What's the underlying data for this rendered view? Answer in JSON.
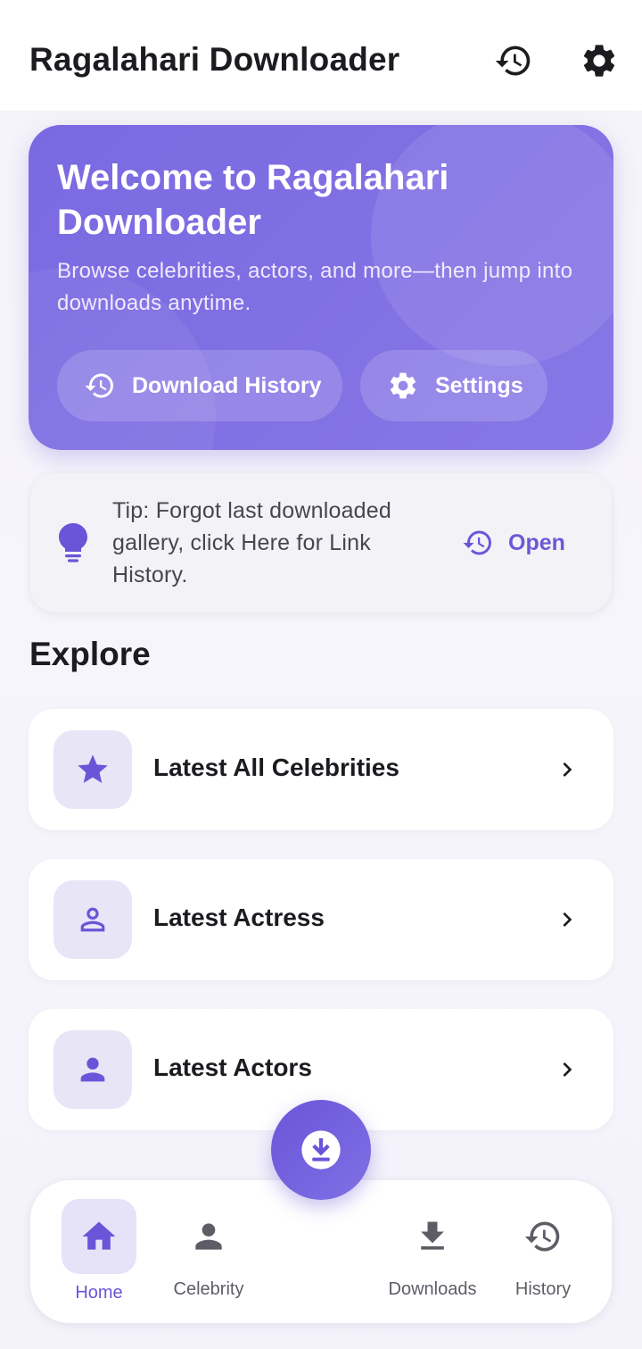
{
  "appbar": {
    "title": "Ragalahari Downloader",
    "history_icon": "history-icon",
    "settings_icon": "gear-icon"
  },
  "hero": {
    "title": "Welcome to Ragalahari Downloader",
    "subtitle": "Browse celebrities, actors, and more—then jump into downloads anytime.",
    "history_button": "Download History",
    "settings_button": "Settings"
  },
  "tip": {
    "text": "Tip: Forgot last downloaded gallery, click Here for Link History.",
    "action": "Open",
    "icon": "lightbulb-icon"
  },
  "explore": {
    "title": "Explore",
    "items": [
      {
        "label": "Latest All Celebrities",
        "icon": "star-icon"
      },
      {
        "label": "Latest Actress",
        "icon": "person-outline-icon"
      },
      {
        "label": "Latest Actors",
        "icon": "person-icon"
      }
    ]
  },
  "fab": {
    "icon": "download-icon"
  },
  "nav": {
    "items": [
      {
        "label": "Home",
        "icon": "home-icon",
        "active": true
      },
      {
        "label": "Celebrity",
        "icon": "person-icon"
      },
      {
        "label": "Downloads",
        "icon": "download-icon"
      },
      {
        "label": "History",
        "icon": "history-icon"
      }
    ]
  },
  "colors": {
    "accent": "#6a55d8",
    "hero_gradient_start": "#7a69e1",
    "hero_gradient_end": "#8877e6",
    "icon_tile": "#e8e5f7"
  }
}
